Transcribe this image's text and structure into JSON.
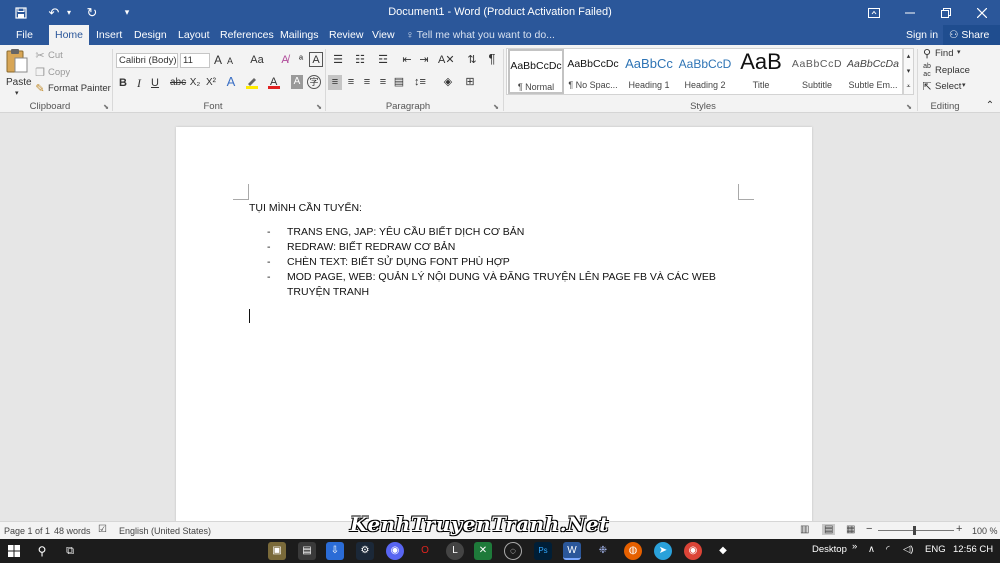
{
  "titlebar": {
    "title": "Document1 - Word (Product Activation Failed)",
    "icons": [
      "save-icon",
      "undo-icon",
      "redo-icon",
      "customize-icon",
      "ribbon-display-icon",
      "minimize-icon",
      "restore-icon",
      "close-icon"
    ]
  },
  "tabs": [
    "File",
    "Home",
    "Insert",
    "Design",
    "Layout",
    "References",
    "Mailings",
    "Review",
    "View"
  ],
  "active_tab": "Home",
  "tell_me": "Tell me what you want to do...",
  "sign_in": "Sign in",
  "share": "Share",
  "clipboard": {
    "paste": "Paste",
    "cut": "Cut",
    "copy": "Copy",
    "format_painter": "Format Painter",
    "label": "Clipboard"
  },
  "font": {
    "name": "Calibri (Body)",
    "size": "11",
    "bold": "B",
    "italic": "I",
    "underline": "U",
    "strike": "abc",
    "subscript": "X₂",
    "superscript": "X²",
    "grow": "A",
    "shrink": "A",
    "change_case": "Aa",
    "label": "Font"
  },
  "paragraph": {
    "label": "Paragraph"
  },
  "styles": {
    "items": [
      {
        "preview": "AaBbCcDc",
        "name": "¶ Normal"
      },
      {
        "preview": "AaBbCcDc",
        "name": "¶ No Spac..."
      },
      {
        "preview": "AaBbCc",
        "name": "Heading 1"
      },
      {
        "preview": "AaBbCcD",
        "name": "Heading 2"
      },
      {
        "preview": "AaB",
        "name": "Title"
      },
      {
        "preview": "AaBbCcD",
        "name": "Subtitle"
      },
      {
        "preview": "AaBbCcDa",
        "name": "Subtle Em..."
      }
    ],
    "label": "Styles"
  },
  "editing": {
    "find": "Find",
    "replace": "Replace",
    "select": "Select",
    "label": "Editing"
  },
  "document": {
    "heading": "TỤI MÌNH CẦN TUYỂN:",
    "items": [
      {
        "dash": "-",
        "text": "TRANS ENG, JAP: YÊU CẦU BIẾT DỊCH CƠ BẢN"
      },
      {
        "dash": "-",
        "text": "REDRAW: BIẾT REDRAW CƠ BẢN"
      },
      {
        "dash": "-",
        "text": "CHÈN TEXT: BIẾT SỬ DỤNG FONT PHÙ HỢP"
      },
      {
        "dash": "-",
        "text": "MOD PAGE, WEB: QUẢN LÝ NỘI DUNG VÀ ĐĂNG TRUYỆN LÊN PAGE FB VÀ CÁC WEB TRUYỆN TRANH"
      }
    ]
  },
  "status": {
    "page": "Page 1 of 1",
    "words": "48 words",
    "language": "English (United States)",
    "zoom": "100 %"
  },
  "watermark": "KenhTruyenTranh.Net",
  "taskbar": {
    "desktop": "Desktop",
    "lang": "ENG",
    "time": "12:56 CH"
  },
  "colors": {
    "accent": "#2b579a",
    "taskbar": "#1c1c1c"
  }
}
